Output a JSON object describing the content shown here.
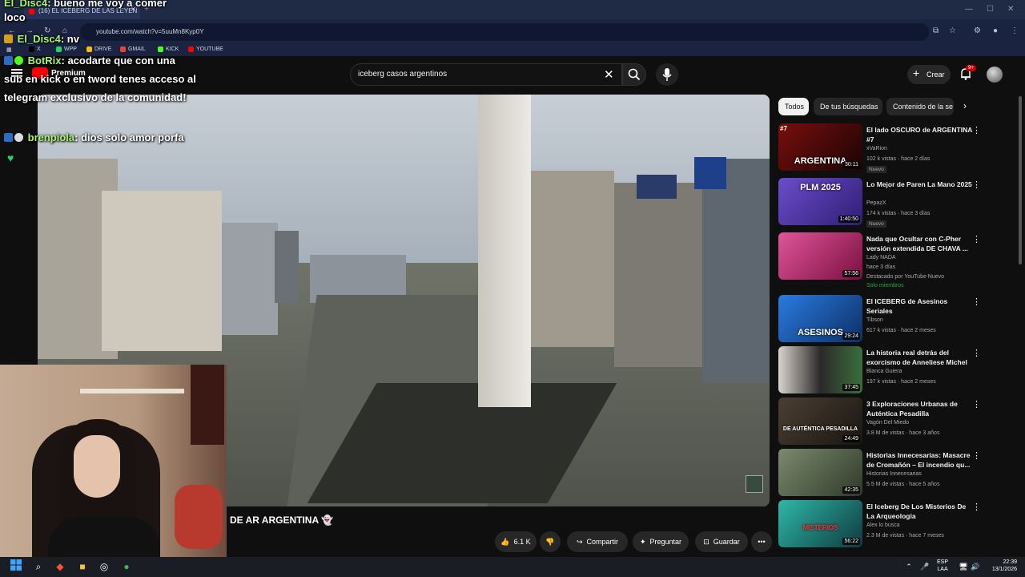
{
  "browser": {
    "tab_title": "(16) EL ICEBERG DE LAS LEYEN",
    "url": "youtube.com/watch?v=5uuMn8Kyp0Y",
    "bookmarks": [
      {
        "label": "X",
        "color": "#000000"
      },
      {
        "label": "WPP",
        "color": "#25d366"
      },
      {
        "label": "DRIVE",
        "color": "#fbbc04"
      },
      {
        "label": "GMAIL",
        "color": "#ea4335"
      },
      {
        "label": "KICK",
        "color": "#53fc18"
      },
      {
        "label": "YOUTUBE",
        "color": "#ff0000"
      }
    ]
  },
  "youtube": {
    "logo_label": "Premium",
    "search_query": "iceberg casos argentinos",
    "create_label": "Crear",
    "notif_count": "9+",
    "video_title": "DE AR ARGENTINA",
    "actions": {
      "likes": "6.1 K",
      "share": "Compartir",
      "ask": "Preguntar",
      "save": "Guardar"
    },
    "chips": [
      "Todos",
      "De tus búsquedas",
      "Contenido de la se"
    ],
    "related": [
      {
        "title": "El lado OSCURO de ARGENTINA #7",
        "channel": "xVaRion",
        "meta": "102 k vistas · hace 2 días",
        "tag": "Nuevo",
        "duration": "30:11",
        "thumb_text": "ARGENTINA",
        "thumb_num": "#7",
        "thumb_color": "#4a0b0b"
      },
      {
        "title": "Lo Mejor de Paren La Mano 2025",
        "channel": "PepazX",
        "meta": "174 k vistas · hace 3 días",
        "tag": "Nuevo",
        "duration": "1:40:50",
        "thumb_text": "PLM 2025",
        "thumb_num": "",
        "thumb_color": "#5b3fb0"
      },
      {
        "title": "Nada que Ocultar con C-Pher versión extendida DE CHAVA ...",
        "channel": "Lady NADA",
        "meta": "hace 3 días",
        "tag": "Destacado por YouTube  Nuevo",
        "extra": "Solo miembros",
        "duration": "57:56",
        "thumb_text": "",
        "thumb_num": "",
        "thumb_color": "#c2185b"
      },
      {
        "title": "El ICEBERG de Asesinos Seriales",
        "channel": "Tibson",
        "meta": "617 k vistas · hace 2 meses",
        "tag": "",
        "duration": "29:24",
        "thumb_text": "ASESINOS",
        "thumb_num": "",
        "thumb_color": "#1f5fa8"
      },
      {
        "title": "La historia real detrás del exorcismo de Anneliese Michel",
        "channel": "Blanca Guiera",
        "meta": "197 k vistas · hace 2 meses",
        "tag": "",
        "duration": "37:45",
        "thumb_text": "",
        "thumb_num": "",
        "thumb_color": "#3c3c3c"
      },
      {
        "title": "3 Exploraciones Urbanas de Auténtica Pesadilla",
        "channel": "Vagón Del Miedo",
        "meta": "3.8 M de vistas · hace 3 años",
        "tag": "",
        "duration": "24:49",
        "thumb_text": "DE AUTÉNTICA PESADILLA",
        "thumb_num": "",
        "thumb_color": "#2f2a24"
      },
      {
        "title": "Historias Innecesarias: Masacre de Cromañón – El incendio qu...",
        "channel": "Historias Innecesarias",
        "meta": "5.5 M de vistas · hace 5 años",
        "tag": "",
        "duration": "42:35",
        "thumb_text": "",
        "thumb_num": "",
        "thumb_color": "#4e5a4c"
      },
      {
        "title": "El Iceberg De Los Misterios De La Arqueología",
        "channel": "Alex lo busca",
        "meta": "2.3 M de vistas · hace 7 meses",
        "tag": "",
        "duration": "56:22",
        "thumb_text": "MISTERIOS",
        "thumb_num": "",
        "thumb_color": "#1f6f6a"
      }
    ]
  },
  "chat": [
    {
      "name": "El_Disc4",
      "msg": ": bueno me voy a comer",
      "continued": "loco"
    },
    {
      "name": "El_Disc4",
      "msg": ": nv"
    },
    {
      "name": "BotRix",
      "msg": ": acodarte que con una",
      "continued": "sub en kick o en tword tenes acceso al telegram exclusivo de la comunidad!"
    },
    {
      "name": "brenpiola",
      "msg": ": dios solo amor porfa"
    }
  ],
  "taskbar": {
    "lang_top": "ESP",
    "lang_bottom": "LAA",
    "time": "22:39",
    "date": "13/1/2026"
  }
}
